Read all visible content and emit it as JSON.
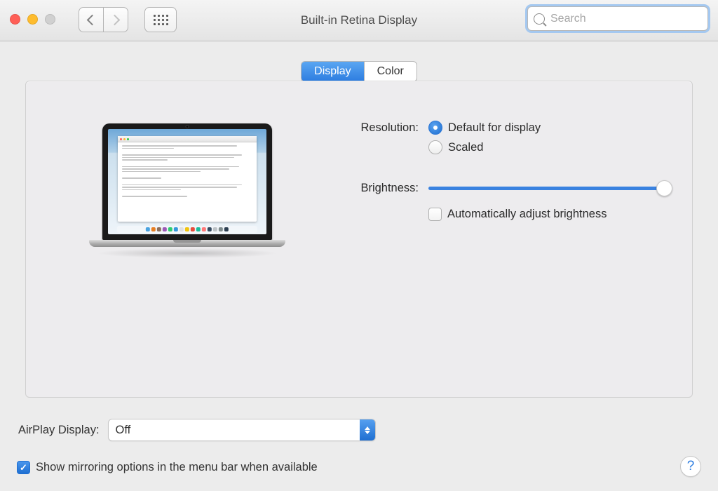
{
  "window": {
    "title": "Built-in Retina Display",
    "search_placeholder": "Search"
  },
  "tabs": {
    "display": "Display",
    "color": "Color",
    "active": "display"
  },
  "settings": {
    "resolution": {
      "label": "Resolution:",
      "options": {
        "default": "Default for display",
        "scaled": "Scaled"
      },
      "selected": "default"
    },
    "brightness": {
      "label": "Brightness:",
      "value_percent": 100,
      "auto_label": "Automatically adjust brightness",
      "auto_checked": false
    }
  },
  "airplay": {
    "label": "AirPlay Display:",
    "value": "Off"
  },
  "mirroring": {
    "label": "Show mirroring options in the menu bar when available",
    "checked": true
  },
  "help_glyph": "?"
}
